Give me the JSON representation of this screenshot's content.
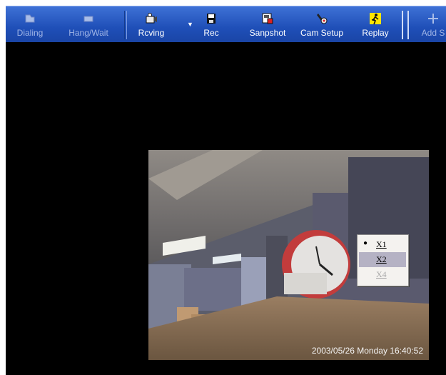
{
  "toolbar": {
    "dialing_label": "Dialing",
    "hangwait_label": "Hang/Wait",
    "rcving_label": "Rcving",
    "rec_label": "Rec",
    "snapshot_label": "Sanpshot",
    "cam_setup_label": "Cam Setup",
    "replay_label": "Replay",
    "add_label": "Add S"
  },
  "video": {
    "timestamp": "2003/05/26 Monday 16:40:52"
  },
  "zoom_menu": {
    "items": [
      {
        "label": "X1",
        "checked": true,
        "state": "normal"
      },
      {
        "label": "X2",
        "checked": false,
        "state": "highlighted"
      },
      {
        "label": "X4",
        "checked": false,
        "state": "disabled"
      }
    ]
  },
  "colors": {
    "toolbar_blue": "#2a5cc4",
    "menu_highlight": "#b5b2c4",
    "video_background": "#000000"
  }
}
